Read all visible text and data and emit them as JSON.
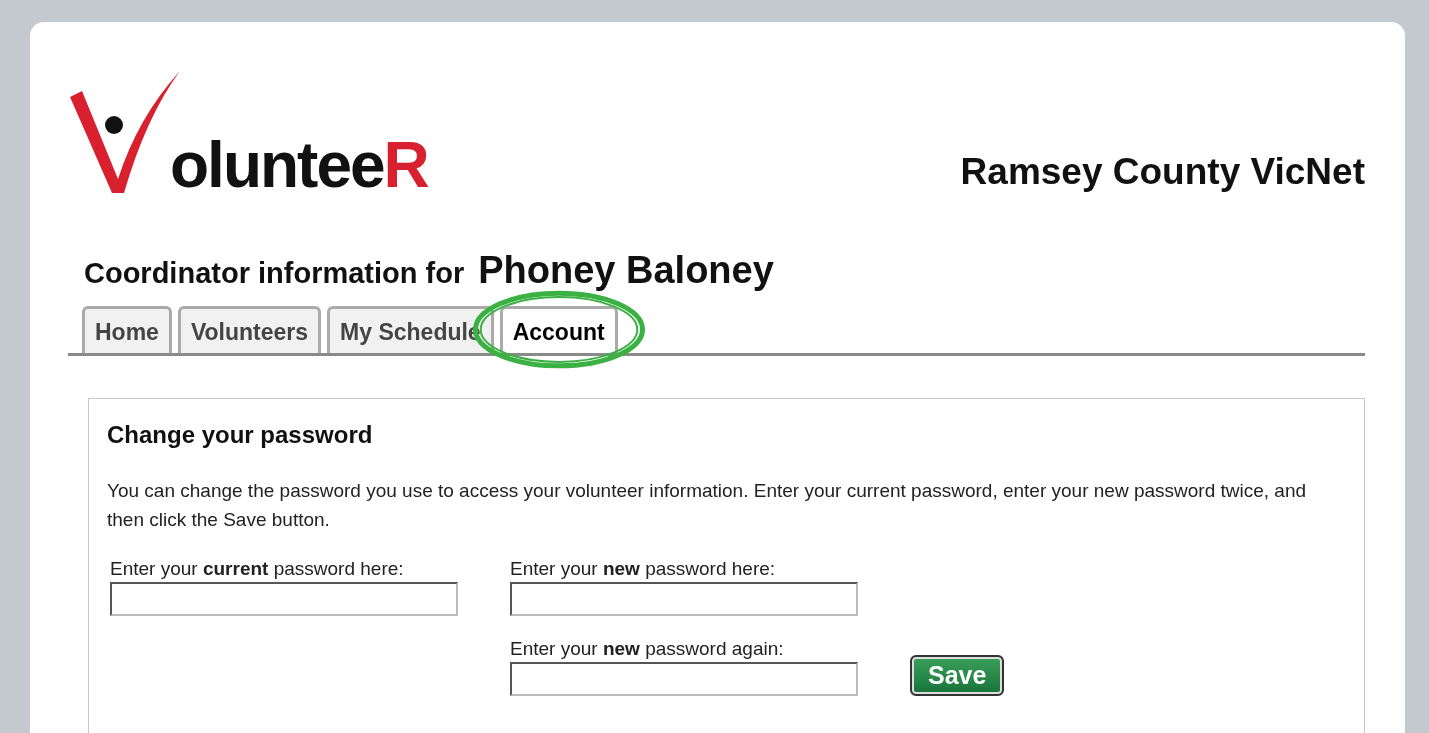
{
  "logo": {
    "text": "oluntee",
    "tail": "R"
  },
  "site_title": "Ramsey County VicNet",
  "heading": {
    "label": "Coordinator information for",
    "name": "Phoney Baloney"
  },
  "tabs": [
    {
      "label": "Home",
      "selected": false,
      "highlighted": false
    },
    {
      "label": "Volunteers",
      "selected": false,
      "highlighted": false
    },
    {
      "label": "My Schedule",
      "selected": false,
      "highlighted": false
    },
    {
      "label": "Account",
      "selected": true,
      "highlighted": true
    }
  ],
  "panel": {
    "title": "Change your password",
    "intro": "You can change the password you use to access your volunteer information. Enter your current password, enter your new password twice, and then click the Save button.",
    "fields": [
      {
        "label": "Enter your **current** password here:"
      },
      {
        "label": "Enter your **new** password here:"
      },
      {
        "label": "Enter your **new** password again:"
      }
    ],
    "save_button": "Save"
  }
}
